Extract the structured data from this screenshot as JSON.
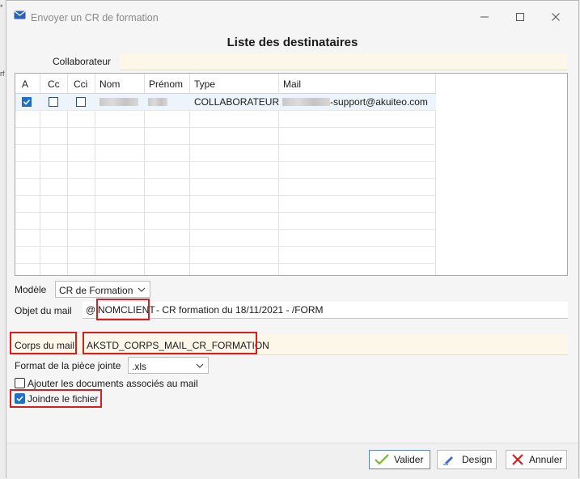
{
  "window": {
    "title": "Envoyer un CR de formation"
  },
  "edge": {
    "glyphs": [
      "*",
      "rf"
    ]
  },
  "heading": "Liste des destinataires",
  "collaborateur": {
    "label": "Collaborateur",
    "value": ""
  },
  "grid": {
    "columns": [
      "A",
      "Cc",
      "Cci",
      "Nom",
      "Prénom",
      "Type",
      "Mail"
    ],
    "rows": [
      {
        "a": true,
        "cc": false,
        "cci": false,
        "nom": "",
        "prenom": "",
        "type": "COLLABORATEUR",
        "mail": "-support@akuiteo.com"
      }
    ]
  },
  "modele": {
    "label": "Modèle",
    "value": "CR de Formation"
  },
  "objet": {
    "label": "Objet du mail",
    "prefix": "@",
    "token": "NOMCLIENT",
    "suffix": " - CR formation du 18/11/2021 - /FORM"
  },
  "corps": {
    "label": "Corps du mail",
    "value": "AKSTD_CORPS_MAIL_CR_FORMATION"
  },
  "format": {
    "label": "Format de la pièce jointe",
    "value": ".xls"
  },
  "options": {
    "ajouter": {
      "label": "Ajouter les documents associés au mail",
      "checked": false
    },
    "joindre": {
      "label": "Joindre le fichier",
      "checked": true
    }
  },
  "buttons": {
    "valider": "Valider",
    "design": "Design",
    "annuler": "Annuler"
  },
  "colors": {
    "accent": "#1f6fc9",
    "highlight": "#d32020",
    "field_bg": "#fdf7e9"
  }
}
